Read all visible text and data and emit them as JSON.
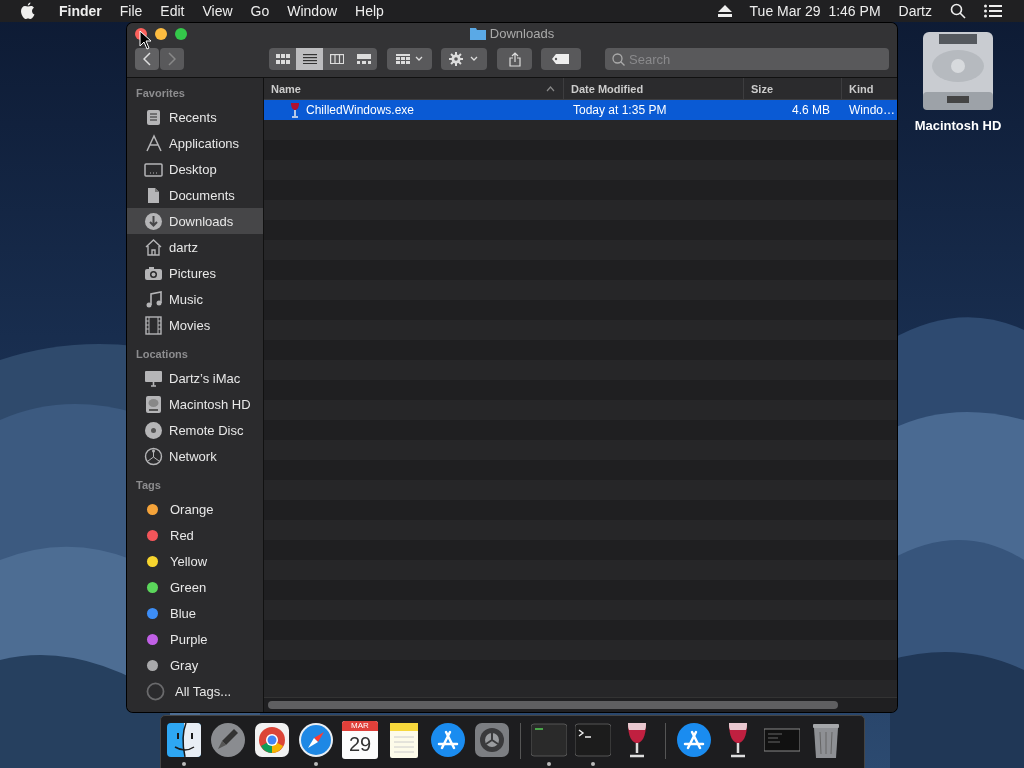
{
  "menu_bar": {
    "app": "Finder",
    "menus": [
      "File",
      "Edit",
      "View",
      "Go",
      "Window",
      "Help"
    ],
    "clock": "Tue Mar 29  1:46 PM",
    "user": "Dartz"
  },
  "desktop_icons": [
    {
      "label": "Macintosh HD"
    }
  ],
  "window": {
    "title": "Downloads",
    "search": {
      "placeholder": "Search"
    },
    "view_modes": [
      {
        "kind": "icons",
        "selected": false
      },
      {
        "kind": "list",
        "selected": true
      },
      {
        "kind": "columns",
        "selected": false
      },
      {
        "kind": "gallery",
        "selected": false
      }
    ]
  },
  "sidebar": {
    "sections": [
      {
        "heading": "Favorites",
        "items": [
          {
            "label": "Recents",
            "kind": "recents",
            "selected": false
          },
          {
            "label": "Applications",
            "kind": "applications",
            "selected": false
          },
          {
            "label": "Desktop",
            "kind": "desktop",
            "selected": false
          },
          {
            "label": "Documents",
            "kind": "documents",
            "selected": false
          },
          {
            "label": "Downloads",
            "kind": "downloads",
            "selected": true
          },
          {
            "label": "dartz",
            "kind": "home",
            "selected": false
          },
          {
            "label": "Pictures",
            "kind": "pictures",
            "selected": false
          },
          {
            "label": "Music",
            "kind": "music",
            "selected": false
          },
          {
            "label": "Movies",
            "kind": "movies",
            "selected": false
          }
        ]
      },
      {
        "heading": "Locations",
        "items": [
          {
            "label": "Dartz’s iMac",
            "kind": "computer",
            "selected": false
          },
          {
            "label": "Macintosh HD",
            "kind": "disk",
            "selected": false
          },
          {
            "label": "Remote Disc",
            "kind": "disc",
            "selected": false
          },
          {
            "label": "Network",
            "kind": "network",
            "selected": false
          }
        ]
      },
      {
        "heading": "Tags",
        "items": [
          {
            "label": "Orange",
            "kind": "tag",
            "color": "#f5a33a",
            "selected": false
          },
          {
            "label": "Red",
            "kind": "tag",
            "color": "#f2555a",
            "selected": false
          },
          {
            "label": "Yellow",
            "kind": "tag",
            "color": "#f7d52e",
            "selected": false
          },
          {
            "label": "Green",
            "kind": "tag",
            "color": "#5bd65b",
            "selected": false
          },
          {
            "label": "Blue",
            "kind": "tag",
            "color": "#3d8ef7",
            "selected": false
          },
          {
            "label": "Purple",
            "kind": "tag",
            "color": "#c160e6",
            "selected": false
          },
          {
            "label": "Gray",
            "kind": "tag",
            "color": "#a9a9ab",
            "selected": false
          },
          {
            "label": "All Tags...",
            "kind": "all-tags",
            "selected": false
          }
        ]
      }
    ]
  },
  "table": {
    "columns": [
      {
        "label": "Name",
        "sorted": true
      },
      {
        "label": "Date Modified",
        "sorted": false
      },
      {
        "label": "Size",
        "sorted": false
      },
      {
        "label": "Kind",
        "sorted": false
      }
    ],
    "rows": [
      {
        "name": "ChilledWindows.exe",
        "date_modified": "Today at 1:35 PM",
        "size": "4.6 MB",
        "file_kind": "Windo…",
        "selected": true
      }
    ]
  },
  "dock": {
    "items": [
      {
        "kind": "finder",
        "running": true
      },
      {
        "kind": "launchpad",
        "running": false
      },
      {
        "kind": "chrome",
        "running": false
      },
      {
        "kind": "safari",
        "running": true
      },
      {
        "kind": "calendar",
        "running": false,
        "month": "MAR",
        "day": "29"
      },
      {
        "kind": "notes",
        "running": false
      },
      {
        "kind": "appstore",
        "running": false
      },
      {
        "kind": "preferences",
        "running": false
      },
      {
        "kind": "separator"
      },
      {
        "kind": "console",
        "running": true
      },
      {
        "kind": "terminal",
        "running": true
      },
      {
        "kind": "wine",
        "running": false
      },
      {
        "kind": "separator"
      },
      {
        "kind": "appstore",
        "running": false
      },
      {
        "kind": "wine",
        "running": false
      },
      {
        "kind": "screen",
        "running": false
      },
      {
        "kind": "trash",
        "running": false
      }
    ]
  }
}
